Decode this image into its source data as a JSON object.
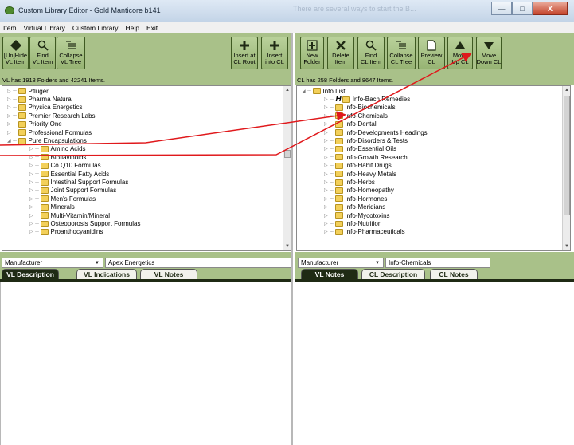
{
  "window": {
    "title": "Custom Library Editor - Gold Manticore b141",
    "ghost_title": "There are several ways to start the B...",
    "controls": [
      "minimize",
      "maximize",
      "close"
    ]
  },
  "menu": [
    "Item",
    "Virtual Library",
    "Custom Library",
    "Help",
    "Exit"
  ],
  "left": {
    "toolbar": [
      {
        "label": "[Un]Hide\nVL Item",
        "icon": "diamond-icon"
      },
      {
        "label": "Find\nVL Item",
        "icon": "magnifier-icon"
      },
      {
        "label": "Collapse\nVL Tree",
        "icon": "collapse-list-icon"
      },
      {
        "label": "Insert at\nCL Root",
        "icon": "plus-icon"
      },
      {
        "label": "Insert\ninto CL",
        "icon": "plus-icon"
      }
    ],
    "status": "VL has 1918 Folders and 42241 Items.",
    "tree": [
      {
        "label": "Pfluger",
        "level": 0,
        "expanded": false
      },
      {
        "label": "Pharma Natura",
        "level": 0,
        "expanded": false
      },
      {
        "label": "Physica Energetics",
        "level": 0,
        "expanded": false
      },
      {
        "label": "Premier Research Labs",
        "level": 0,
        "expanded": false
      },
      {
        "label": "Priority One",
        "level": 0,
        "expanded": false
      },
      {
        "label": "Professional Formulas",
        "level": 0,
        "expanded": false
      },
      {
        "label": "Pure Encapsulations",
        "level": 0,
        "expanded": true
      },
      {
        "label": "Amino Acids",
        "level": 1,
        "expanded": false
      },
      {
        "label": "Bioflavinoids",
        "level": 1,
        "expanded": false
      },
      {
        "label": "Co Q10 Formulas",
        "level": 1,
        "expanded": false
      },
      {
        "label": "Essential Fatty Acids",
        "level": 1,
        "expanded": false
      },
      {
        "label": "Intestinal Support Formulas",
        "level": 1,
        "expanded": false
      },
      {
        "label": "Joint Support Formulas",
        "level": 1,
        "expanded": false
      },
      {
        "label": "Men's Formulas",
        "level": 1,
        "expanded": false
      },
      {
        "label": "Minerals",
        "level": 1,
        "expanded": false
      },
      {
        "label": "Multi-Vitamin/Mineral",
        "level": 1,
        "expanded": false
      },
      {
        "label": "Osteoporosis Support Formulas",
        "level": 1,
        "expanded": false
      },
      {
        "label": "Proanthocyanidins",
        "level": 1,
        "expanded": false
      }
    ],
    "category": "Manufacturer",
    "value": "Apex Energetics",
    "tabs": [
      "VL Description",
      "VL Indications",
      "VL Notes"
    ],
    "active_tab": 0
  },
  "right": {
    "toolbar": [
      {
        "label": "New\nFolder",
        "icon": "new-folder-icon"
      },
      {
        "label": "Delete\nItem",
        "icon": "x-icon"
      },
      {
        "label": "Find\nCL Item",
        "icon": "magnifier-icon"
      },
      {
        "label": "Collapse\nCL Tree",
        "icon": "collapse-list-icon"
      },
      {
        "label": "Preview\nCL",
        "icon": "page-icon"
      },
      {
        "label": "Move\nUp CL",
        "icon": "arrow-up-icon"
      },
      {
        "label": "Move\nDown CL",
        "icon": "arrow-down-icon"
      }
    ],
    "status": "CL has 258 Folders and 8647 Items.",
    "tree": [
      {
        "label": "Info List",
        "level": 0,
        "expanded": true
      },
      {
        "label": "Info-Bach Remedies",
        "level": 1,
        "expanded": false,
        "marker": "H"
      },
      {
        "label": "Info-Biochemicals",
        "level": 1,
        "expanded": false
      },
      {
        "label": "Info-Chemicals",
        "level": 1,
        "expanded": false
      },
      {
        "label": "Info-Dental",
        "level": 1,
        "expanded": false
      },
      {
        "label": "Info-Developments Headings",
        "level": 1,
        "expanded": false
      },
      {
        "label": "Info-Disorders & Tests",
        "level": 1,
        "expanded": false
      },
      {
        "label": "Info-Essential Oils",
        "level": 1,
        "expanded": false
      },
      {
        "label": "Info-Growth Research",
        "level": 1,
        "expanded": false
      },
      {
        "label": "Info-Habit Drugs",
        "level": 1,
        "expanded": false
      },
      {
        "label": "Info-Heavy Metals",
        "level": 1,
        "expanded": false
      },
      {
        "label": "Info-Herbs",
        "level": 1,
        "expanded": false
      },
      {
        "label": "Info-Homeopathy",
        "level": 1,
        "expanded": false
      },
      {
        "label": "Info-Hormones",
        "level": 1,
        "expanded": false
      },
      {
        "label": "Info-Meridians",
        "level": 1,
        "expanded": false
      },
      {
        "label": "Info-Mycotoxins",
        "level": 1,
        "expanded": false
      },
      {
        "label": "Info-Nutrition",
        "level": 1,
        "expanded": false
      },
      {
        "label": "Info-Pharmaceuticals",
        "level": 1,
        "expanded": false
      }
    ],
    "category": "Manufacturer",
    "value": "Info-Chemicals",
    "tabs": [
      "VL Notes",
      "CL Description",
      "CL Notes"
    ],
    "active_tab": 0
  },
  "colors": {
    "toolbar_green": "#a9c189",
    "tab_active": "#1f2a14",
    "annotation_arrow": "#e0191c",
    "folder_yellow": "#f3d05a"
  }
}
